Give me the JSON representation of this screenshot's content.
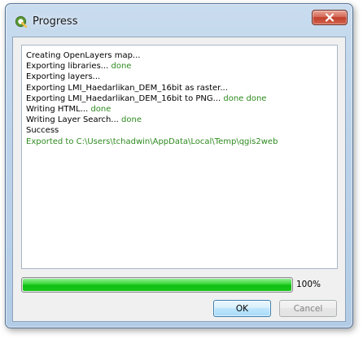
{
  "window": {
    "title": "Progress",
    "close_glyph": "×"
  },
  "log": {
    "lines": [
      {
        "text": "Creating OpenLayers map...",
        "suffix": ""
      },
      {
        "text": "Exporting libraries...",
        "suffix": " done"
      },
      {
        "text": "Exporting layers...",
        "suffix": ""
      },
      {
        "text": "Exporting LMI_Haedarlikan_DEM_16bit as raster...",
        "suffix": ""
      },
      {
        "text": "Exporting LMI_Haedarlikan_DEM_16bit to PNG...",
        "suffix": " done done"
      },
      {
        "text": "Writing HTML...",
        "suffix": " done"
      },
      {
        "text": "Writing Layer Search...",
        "suffix": " done"
      },
      {
        "text": "Success",
        "suffix": ""
      },
      {
        "text": "Exported to C:\\Users\\tchadwin\\AppData\\Local\\Temp\\qgis2web",
        "suffix": ""
      }
    ]
  },
  "progress": {
    "value": 100,
    "label": "100%"
  },
  "buttons": {
    "ok_label": "OK",
    "cancel_label": "Cancel"
  },
  "colors": {
    "done_text": "#2e8b1f",
    "progress_fill": "#1ac61c",
    "close_button": "#c0402c"
  },
  "icons": {
    "app": "qgis-icon",
    "close": "close-icon"
  }
}
